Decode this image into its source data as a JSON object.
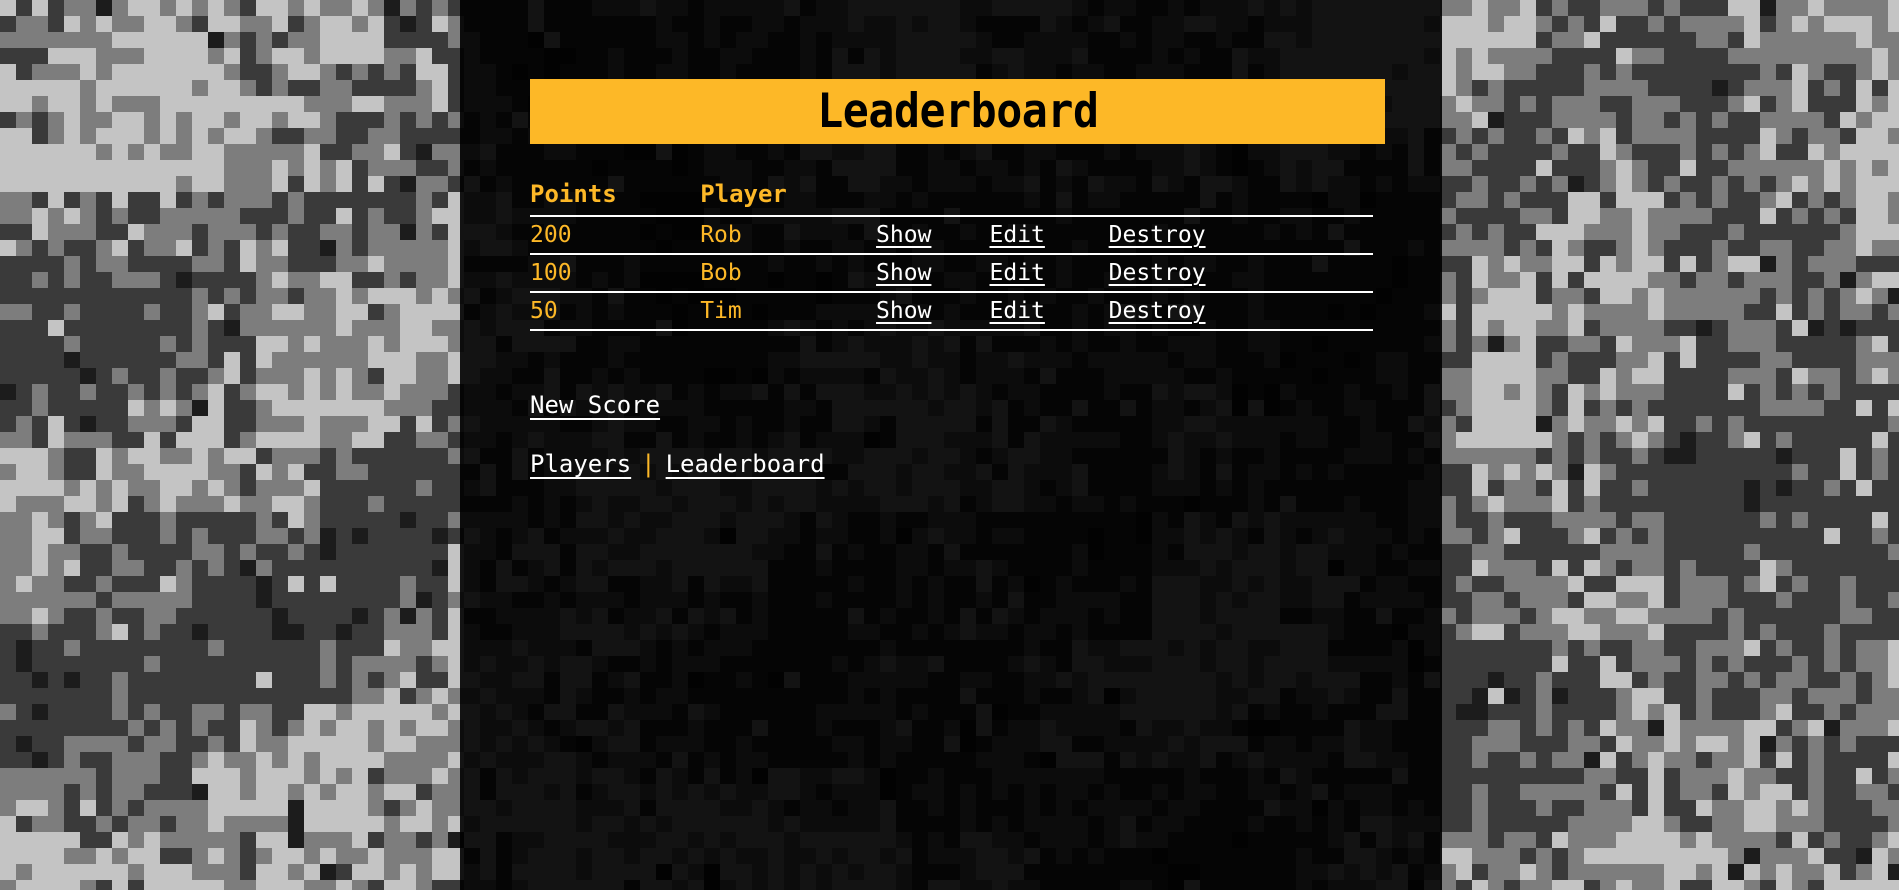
{
  "page": {
    "title": "Leaderboard",
    "accent_color": "#FDB827",
    "panel_color": "#000000",
    "link_color": "#FFFFFF",
    "background": {
      "pattern": "digital-camouflage",
      "colors": [
        "#3a3a3a",
        "#c4c4c4",
        "#7d7d7d",
        "#1c1c1c"
      ]
    }
  },
  "table": {
    "headers": [
      "Points",
      "Player",
      "",
      "",
      ""
    ],
    "actions": {
      "show": "Show",
      "edit": "Edit",
      "destroy": "Destroy"
    },
    "rows": [
      {
        "points": "200",
        "player": "Rob"
      },
      {
        "points": "100",
        "player": "Bob"
      },
      {
        "points": "50",
        "player": "Tim"
      }
    ]
  },
  "links": {
    "new_score": "New Score"
  },
  "footer_nav": {
    "players": "Players",
    "separator": "|",
    "leaderboard": "Leaderboard"
  }
}
